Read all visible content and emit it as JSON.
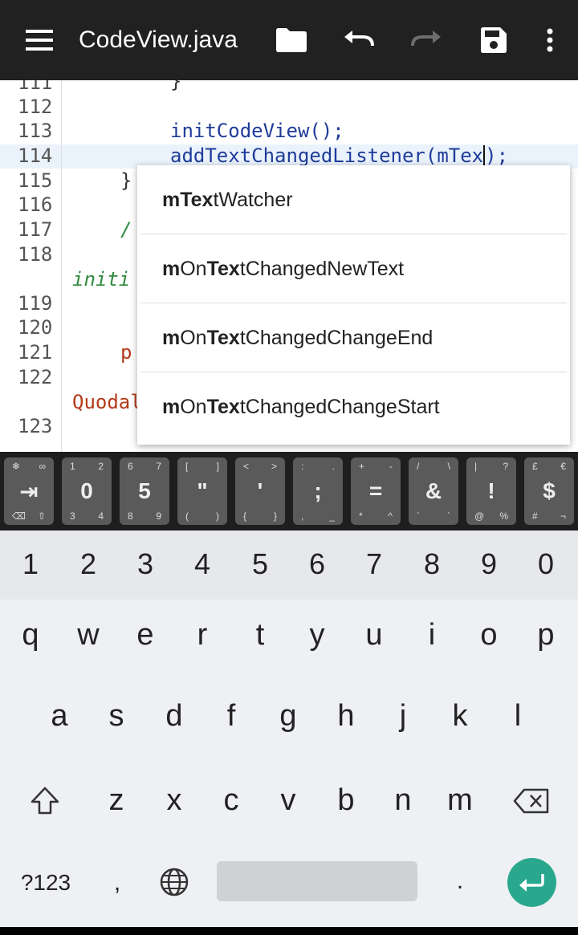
{
  "appbar": {
    "title": "CodeView.java",
    "icons": [
      "menu-icon",
      "folder-icon",
      "undo-icon",
      "redo-icon",
      "save-icon",
      "more-vert-icon"
    ]
  },
  "editor": {
    "line_numbers": [
      "111",
      "112",
      "113",
      "114",
      "115",
      "116",
      "117",
      "118",
      "119",
      "120",
      "121",
      "122",
      "123"
    ],
    "lines": {
      "l111": "}",
      "l113": "initCodeView();",
      "l114": "addTextChangedListener(mTex",
      "l114_end": ");",
      "l115": "}",
      "l117": "/",
      "l118": "initi",
      "l121": "p",
      "l122": "Quodal"
    }
  },
  "autocomplete": {
    "items": [
      {
        "pre": "",
        "bold1": "mTex",
        "mid": "",
        "bold2": "",
        "rest": "tWatcher"
      },
      {
        "pre": "",
        "bold1": "m",
        "mid": "On",
        "bold2": "Tex",
        "rest": "tChangedNewText"
      },
      {
        "pre": "",
        "bold1": "m",
        "mid": "On",
        "bold2": "Tex",
        "rest": "tChangedChangeEnd"
      },
      {
        "pre": "",
        "bold1": "m",
        "mid": "On",
        "bold2": "Tex",
        "rest": "tChangedChangeStart"
      }
    ]
  },
  "symbol_bar": {
    "keys": [
      {
        "main": "⇥",
        "tl": "❄",
        "tr": "∞",
        "bl": "⌫",
        "br": "⇧"
      },
      {
        "main": "0",
        "tl": "1",
        "tr": "2",
        "bl": "3",
        "br": "4"
      },
      {
        "main": "5",
        "tl": "6",
        "tr": "7",
        "bl": "8",
        "br": "9"
      },
      {
        "main": "\"",
        "tl": "[",
        "tr": "]",
        "bl": "(",
        "br": ")"
      },
      {
        "main": "'",
        "tl": "<",
        "tr": ">",
        "bl": "{",
        "br": "}"
      },
      {
        "main": ";",
        "tl": ":",
        "tr": ".",
        "bl": ",",
        "br": "_"
      },
      {
        "main": "=",
        "tl": "+",
        "tr": "-",
        "bl": "*",
        "br": "^"
      },
      {
        "main": "&",
        "tl": "/",
        "tr": "\\",
        "bl": "`",
        "br": "`"
      },
      {
        "main": "!",
        "tl": "|",
        "tr": "?",
        "bl": "@",
        "br": "%"
      },
      {
        "main": "$",
        "tl": "£",
        "tr": "€",
        "bl": "#",
        "br": "¬"
      }
    ]
  },
  "keyboard": {
    "numbers": [
      "1",
      "2",
      "3",
      "4",
      "5",
      "6",
      "7",
      "8",
      "9",
      "0"
    ],
    "row1": [
      "q",
      "w",
      "e",
      "r",
      "t",
      "y",
      "u",
      "i",
      "o",
      "p"
    ],
    "row2": [
      "a",
      "s",
      "d",
      "f",
      "g",
      "h",
      "j",
      "k",
      "l"
    ],
    "row3": [
      "z",
      "x",
      "c",
      "v",
      "b",
      "n",
      "m"
    ],
    "sym_label": "?123",
    "comma": ",",
    "period": ".",
    "icons": [
      "shift-icon",
      "backspace-icon",
      "globe-icon",
      "enter-icon"
    ]
  }
}
